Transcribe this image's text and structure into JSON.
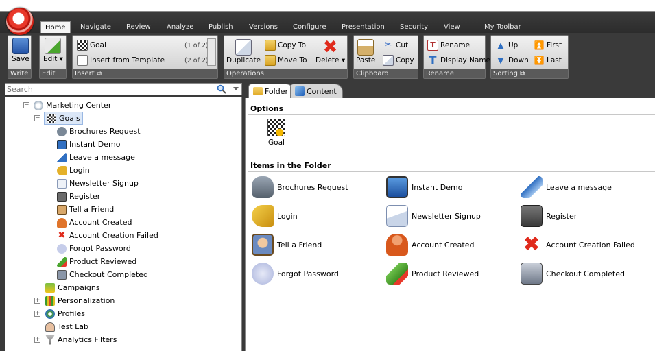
{
  "tabs": [
    "Home",
    "Navigate",
    "Review",
    "Analyze",
    "Publish",
    "Versions",
    "Configure",
    "Presentation",
    "Security",
    "View",
    "My Toolbar"
  ],
  "ribbon": {
    "write": {
      "save_label": "Save",
      "group": "Write"
    },
    "edit": {
      "edit_label": "Edit",
      "group": "Edit"
    },
    "insert": {
      "goal_label": "Goal",
      "goal_count": "(1 of 2)",
      "template_label": "Insert from Template",
      "template_count": "(2 of 2)",
      "group": "Insert"
    },
    "operations": {
      "duplicate": "Duplicate",
      "copy_to": "Copy To",
      "move_to": "Move To",
      "delete": "Delete",
      "group": "Operations"
    },
    "clipboard": {
      "paste": "Paste",
      "cut": "Cut",
      "copy": "Copy",
      "group": "Clipboard"
    },
    "rename": {
      "rename": "Rename",
      "display_name": "Display Name",
      "group": "Rename"
    },
    "sorting": {
      "up": "Up",
      "down": "Down",
      "first": "First",
      "last": "Last",
      "group": "Sorting"
    }
  },
  "search": {
    "placeholder": "Search"
  },
  "tree": {
    "root": "Marketing Center",
    "goals": "Goals",
    "goal_items": [
      "Brochures Request",
      "Instant Demo",
      "Leave a message",
      "Login",
      "Newsletter Signup",
      "Register",
      "Tell a Friend",
      "Account Created",
      "Account Creation Failed",
      "Forgot Password",
      "Product Reviewed",
      "Checkout Completed"
    ],
    "siblings": [
      "Campaigns",
      "Personalization",
      "Profiles",
      "Test Lab",
      "Analytics Filters"
    ]
  },
  "content_tabs": {
    "folder": "Folder",
    "content": "Content"
  },
  "folder": {
    "options_title": "Options",
    "option_goal": "Goal",
    "items_title": "Items in the Folder",
    "items": [
      "Brochures Request",
      "Instant Demo",
      "Leave a message",
      "Login",
      "Newsletter Signup",
      "Register",
      "Tell a Friend",
      "Account Created",
      "Account Creation Failed",
      "Forgot Password",
      "Product Reviewed",
      "Checkout Completed"
    ]
  },
  "colors": {
    "accent": "#2f6fc2",
    "chrome": "#3a3a3a",
    "delete_red": "#e02a1c"
  }
}
